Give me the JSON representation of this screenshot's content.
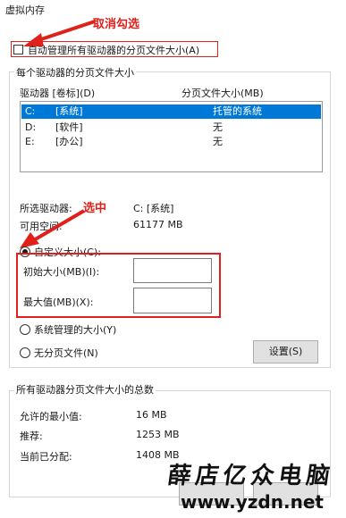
{
  "window": {
    "title": "虚拟内存"
  },
  "auto_manage": {
    "label": "自动管理所有驱动器的分页文件大小(A)",
    "checked": false
  },
  "drives_group": {
    "legend": "每个驱动器的分页文件大小",
    "col_drive": "驱动器 [卷标](D)",
    "col_size": "分页文件大小(MB)",
    "rows": [
      {
        "drive": "C:",
        "label": "[系统]",
        "size": "托管的系统",
        "selected": true
      },
      {
        "drive": "D:",
        "label": "[软件]",
        "size": "无",
        "selected": false
      },
      {
        "drive": "E:",
        "label": "[办公]",
        "size": "无",
        "selected": false
      }
    ]
  },
  "selected_drive": {
    "label": "所选驱动器:",
    "value": "C:  [系统]"
  },
  "space_available": {
    "label": "可用空间:",
    "value": "61177 MB"
  },
  "custom_size": {
    "label": "自定义大小(C):",
    "initial_label": "初始大小(MB)(I):",
    "initial_value": "",
    "max_label": "最大值(MB)(X):",
    "max_value": ""
  },
  "system_managed": {
    "label": "系统管理的大小(Y)"
  },
  "no_paging": {
    "label": "无分页文件(N)"
  },
  "set_button": {
    "label": "设置(S)"
  },
  "totals_group": {
    "legend": "所有驱动器分页文件大小的总数",
    "min_label": "允许的最小值:",
    "min_value": "16 MB",
    "rec_label": "推荐:",
    "rec_value": "1253 MB",
    "cur_label": "当前已分配:",
    "cur_value": "1408 MB"
  },
  "annotations": {
    "uncheck": "取消勾选",
    "select": "选中"
  },
  "watermark": {
    "brand": "薛店亿众电脑",
    "url": "www.yzdn.net"
  },
  "colors": {
    "annotation_red": "#e0201b",
    "selection_blue": "#0078d7"
  }
}
